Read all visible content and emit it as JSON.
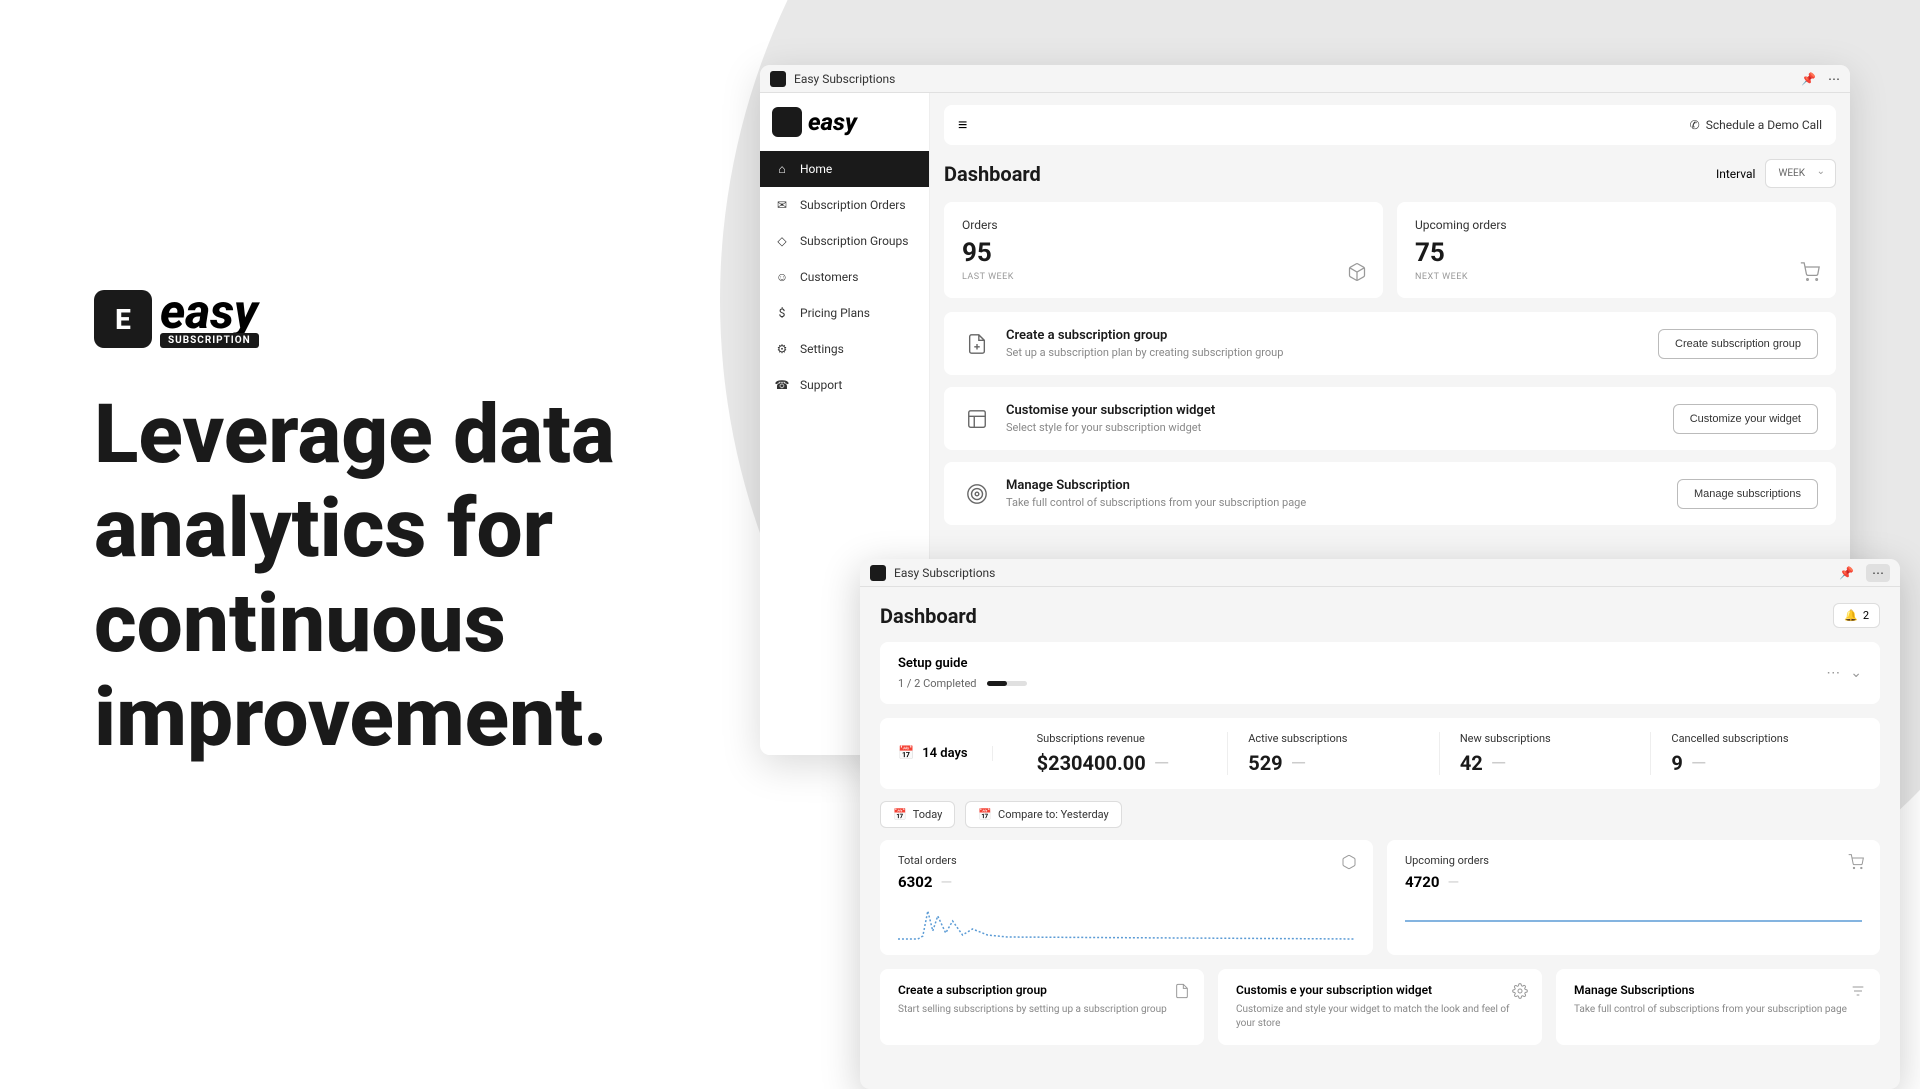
{
  "promo": {
    "brand_main": "easy",
    "brand_sub": "SUBSCRIPTION",
    "headline": "Leverage data analytics for continuous improvement."
  },
  "win1": {
    "title": "Easy Subscriptions",
    "sidebar": {
      "brand": "easy",
      "items": [
        {
          "label": "Home",
          "active": true
        },
        {
          "label": "Subscription Orders"
        },
        {
          "label": "Subscription Groups"
        },
        {
          "label": "Customers"
        },
        {
          "label": "Pricing Plans"
        },
        {
          "label": "Settings"
        },
        {
          "label": "Support"
        }
      ]
    },
    "topbar": {
      "schedule": "Schedule a Demo Call"
    },
    "header": {
      "title": "Dashboard",
      "interval_label": "Interval",
      "interval_value": "WEEK"
    },
    "stats": [
      {
        "label": "Orders",
        "value": "95",
        "sub": "LAST WEEK"
      },
      {
        "label": "Upcoming orders",
        "value": "75",
        "sub": "NEXT WEEK"
      }
    ],
    "actions": [
      {
        "title": "Create a subscription group",
        "sub": "Set up a subscription plan by creating subscription group",
        "btn": "Create subscription group"
      },
      {
        "title": "Customise your subscription widget",
        "sub": "Select style for your subscription widget",
        "btn": "Customize your widget"
      },
      {
        "title": "Manage Subscription",
        "sub": "Take full control of subscriptions from your subscription page",
        "btn": "Manage subscriptions"
      }
    ]
  },
  "win2": {
    "title": "Easy Subscriptions",
    "header": {
      "title": "Dashboard",
      "notif_count": "2"
    },
    "setup": {
      "title": "Setup guide",
      "progress": "1 / 2 Completed"
    },
    "period": "14 days",
    "metrics": [
      {
        "label": "Subscriptions revenue",
        "value": "$230400.00"
      },
      {
        "label": "Active subscriptions",
        "value": "529"
      },
      {
        "label": "New subscriptions",
        "value": "42"
      },
      {
        "label": "Cancelled subscriptions",
        "value": "9"
      }
    ],
    "chips": [
      {
        "label": "Today"
      },
      {
        "label": "Compare to: Yesterday"
      }
    ],
    "charts": [
      {
        "title": "Total orders",
        "value": "6302"
      },
      {
        "title": "Upcoming orders",
        "value": "4720"
      }
    ],
    "cards3": [
      {
        "title": "Create a subscription group",
        "sub": "Start selling subscriptions by setting up a subscription group"
      },
      {
        "title": "Customis e your subscription widget",
        "sub": "Customize and style your widget to match the look and feel of your store"
      },
      {
        "title": "Manage Subscriptions",
        "sub": "Take full control of subscriptions from your subscription page"
      }
    ]
  }
}
